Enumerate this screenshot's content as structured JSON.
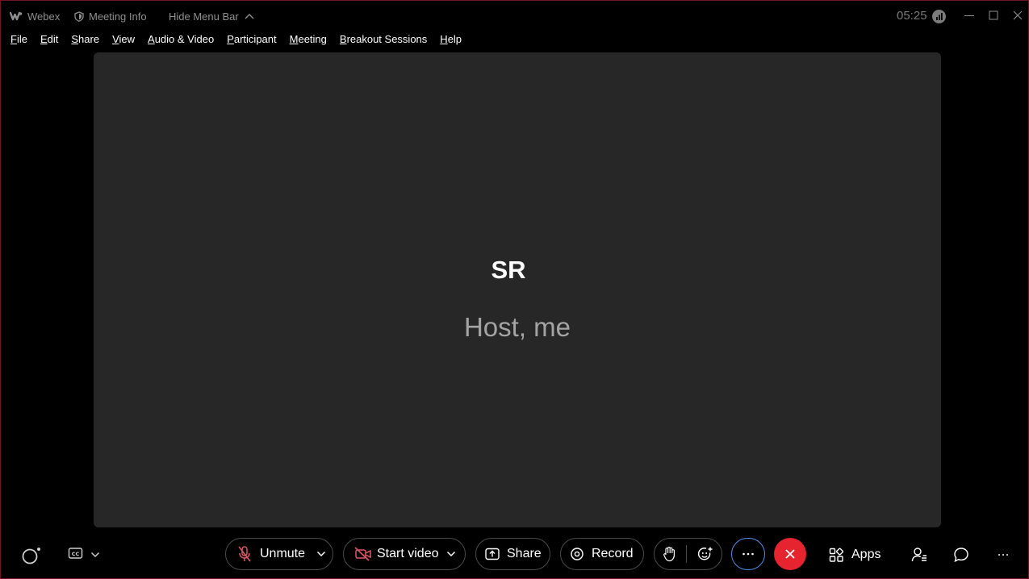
{
  "titlebar": {
    "app_name": "Webex",
    "meeting_info": "Meeting Info",
    "hide_menu": "Hide Menu Bar",
    "clock": "05:25"
  },
  "menu": [
    {
      "u": "F",
      "rest": "ile"
    },
    {
      "u": "E",
      "rest": "dit"
    },
    {
      "u": "S",
      "rest": "hare"
    },
    {
      "u": "V",
      "rest": "iew"
    },
    {
      "u": "A",
      "rest": "udio & Video"
    },
    {
      "u": "P",
      "rest": "articipant"
    },
    {
      "u": "M",
      "rest": "eeting"
    },
    {
      "u": "B",
      "rest": "reakout Sessions"
    },
    {
      "u": "H",
      "rest": "elp"
    }
  ],
  "stage": {
    "initials": "SR",
    "name": "Host, me"
  },
  "controls": {
    "unmute": "Unmute",
    "start_video": "Start video",
    "share": "Share",
    "record": "Record",
    "apps": "Apps"
  },
  "icons": {
    "webex_logo": "webex-logo",
    "shield": "shield-icon",
    "chevron_up": "chevron-up-icon",
    "muted_mic": "mic-off-icon",
    "video_off": "video-off-icon",
    "share": "share-icon",
    "record": "record-icon",
    "raise_hand": "raise-hand-icon",
    "reactions": "reaction-icon",
    "more": "more-icon",
    "leave": "leave-icon",
    "apps": "apps-icon",
    "participants": "participants-icon",
    "chat": "chat-icon",
    "overflow": "overflow-icon",
    "ai_assistant": "assistant-icon",
    "captions": "captions-icon"
  },
  "colors": {
    "leave_red": "#e5242f",
    "accent_blue": "#4f8fe8",
    "muted_red": "#e05561"
  }
}
